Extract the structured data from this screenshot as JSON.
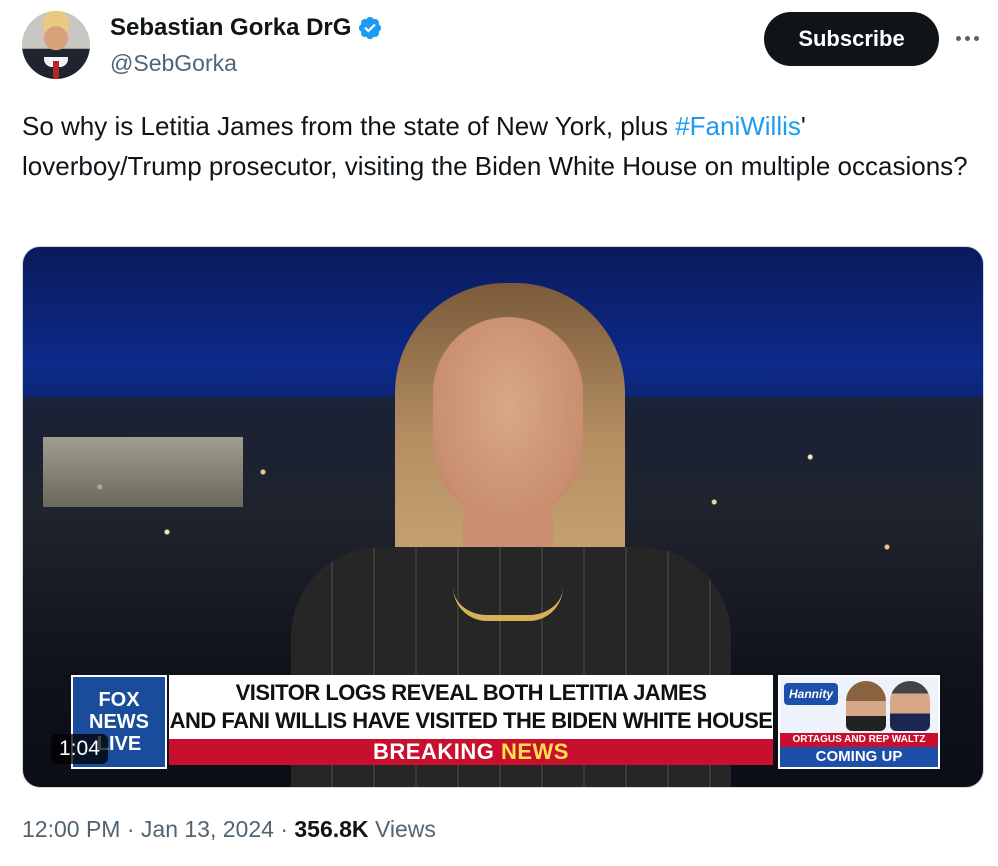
{
  "author": {
    "display_name": "Sebastian Gorka DrG",
    "handle": "@SebGorka"
  },
  "subscribe_label": "Subscribe",
  "tweet": {
    "text_before": "So why is Letitia James from the state of New York, plus ",
    "hashtag": "#FaniWillis",
    "text_after": "' loverboy/Trump prosecutor, visiting the Biden White House on multiple occasions?"
  },
  "video": {
    "duration": "1:04",
    "channel_logo_line1": "FOX",
    "channel_logo_line2": "NEWS",
    "channel_logo_line3": "LIVE",
    "headline_line1": "VISITOR LOGS REVEAL BOTH LETITIA JAMES",
    "headline_line2": "AND FANI WILLIS HAVE VISITED THE BIDEN WHITE HOUSE",
    "breaking_word1": "BREAKING",
    "breaking_word2": "NEWS",
    "promo_show": "Hannity",
    "promo_names": "ORTAGUS AND REP WALTZ",
    "promo_coming": "COMING UP"
  },
  "meta": {
    "time": "12:00 PM",
    "separator": "·",
    "date": "Jan 13, 2024",
    "views_count": "356.8K",
    "views_label": "Views"
  },
  "colors": {
    "accent": "#1d9bf0",
    "text": "#0f1419",
    "secondary": "#536471"
  },
  "icons": [
    "verified-badge-icon",
    "more-options-icon"
  ]
}
